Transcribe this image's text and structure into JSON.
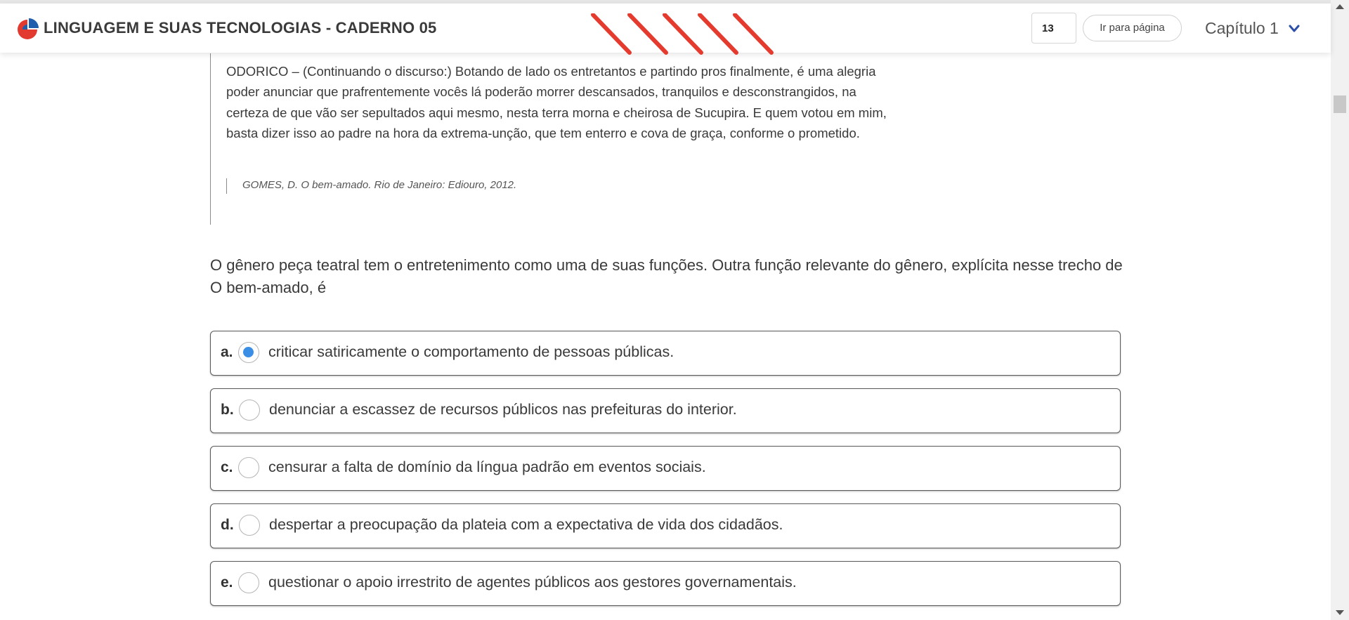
{
  "header": {
    "title": "LINGUAGEM E SUAS TECNOLOGIAS - CADERNO 05",
    "page_number": "13",
    "goto_label": "Ir para página",
    "chapter_label": "Capítulo 1",
    "logo_icon": "logo-icon",
    "chevron_icon": "chevron-down-icon",
    "colors": {
      "logo_red": "#e23a2f",
      "logo_blue": "#1f5fae",
      "stripes": "#e53a2e",
      "accent": "#3a8ee6"
    }
  },
  "passage": {
    "text": "ODORICO – (Continuando o discurso:) Botando de lado os entretantos e partindo pros finalmente, é uma alegria poder anunciar que prafrentemente vocês lá poderão morrer descansados, tranquilos e desconstrangidos, na certeza de que vão ser sepultados aqui mesmo, nesta terra morna e cheirosa de Sucupira. E quem votou em mim, basta dizer isso ao padre na hora da extrema-unção, que tem enterro e cova de graça, conforme o prometido.",
    "reference": "GOMES, D. O bem-amado. Rio de Janeiro: Ediouro, 2012."
  },
  "question": {
    "prompt": "O gênero peça teatral tem o entretenimento como uma de suas funções. Outra função relevante do gênero, explícita nesse trecho de O bem-amado, é",
    "options": [
      {
        "letter": "a.",
        "text": "criticar satiricamente o comportamento de pessoas públicas.",
        "selected": true
      },
      {
        "letter": "b.",
        "text": "denunciar a escassez de recursos públicos nas prefeituras do interior.",
        "selected": false
      },
      {
        "letter": "c.",
        "text": "censurar a falta de domínio da língua padrão em eventos sociais.",
        "selected": false
      },
      {
        "letter": "d.",
        "text": "despertar a preocupação da plateia com a expectativa de vida dos cidadãos.",
        "selected": false
      },
      {
        "letter": "e.",
        "text": "questionar o apoio irrestrito de agentes públicos aos gestores governamentais.",
        "selected": false
      }
    ]
  }
}
